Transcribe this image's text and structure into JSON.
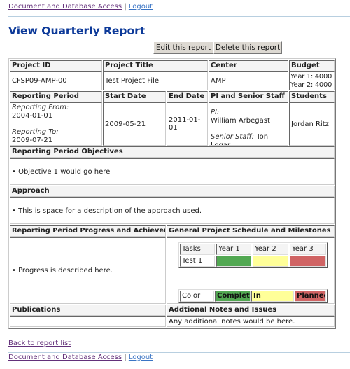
{
  "nav": {
    "docs": "Document and Database Access",
    "sep": "|",
    "logout": "Logout"
  },
  "page_title": "View Quarterly Report",
  "buttons": {
    "edit": "Edit this report",
    "delete": "Delete this report"
  },
  "report": {
    "headers": {
      "project_id": "Project ID",
      "project_title": "Project Title",
      "center": "Center",
      "budget": "Budget",
      "reporting_period": "Reporting Period",
      "start_date": "Start Date",
      "end_date": "End Date",
      "pi_staff": "PI and Senior Staff",
      "students": "Students",
      "objectives": "Reporting Period Objectives",
      "approach": "Approach",
      "progress": "Reporting Period Progress and Achievements",
      "schedule": "General Project Schedule and Milestones",
      "publications": "Publications",
      "notes": "Addtional Notes and Issues"
    },
    "project_id": "CFSP09-AMP-00",
    "project_title": "Test Project File",
    "center": "AMP",
    "budget": [
      "Year 1: 4000",
      "Year 2: 4000"
    ],
    "reporting_from_label": "Reporting From:",
    "reporting_from": "2004-01-01",
    "reporting_to_label": "Reporting To:",
    "reporting_to": "2009-07-21",
    "start_date": "2009-05-21",
    "end_date": "2011-01-01",
    "pi_label": "PI:",
    "pi": "William Arbegast",
    "senior_staff_label": "Senior Staff:",
    "senior_staff": "Toni Logar",
    "students": "Jordan Ritz",
    "objectives": "• Objective 1 would go here",
    "approach": "• This is space for a description of the approach used.",
    "progress": "• Progress is described here.",
    "publications": "",
    "notes": "Any additional notes would be here."
  },
  "schedule": {
    "headers": [
      "Tasks",
      "Year 1",
      "Year 2",
      "Year 3"
    ],
    "rows": [
      {
        "task": "Test 1",
        "status": [
          "complete",
          "in-progress",
          "planned"
        ]
      }
    ]
  },
  "color_key": {
    "label": "Color Key",
    "complete": "Complete",
    "in_progress": "In Progress",
    "planned": "Planned"
  },
  "colors": {
    "complete": "#52a852",
    "in_progress": "#ffff99",
    "planned": "#d06464",
    "title": "#0d3a99"
  },
  "footer": {
    "back": "Back to report list"
  }
}
